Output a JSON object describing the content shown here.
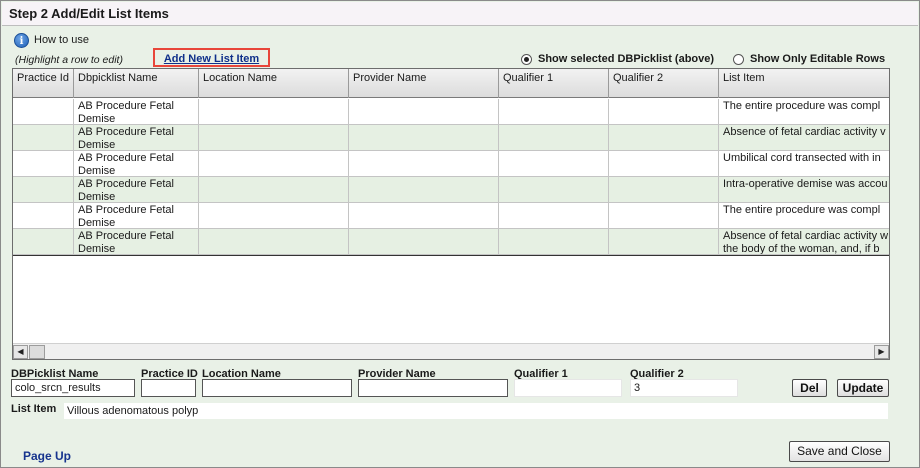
{
  "title": "Step 2 Add/Edit List Items",
  "how_to_use": "How to use",
  "hint": "(Highlight a row to edit)",
  "add_new": "Add New List Item",
  "radio_show_selected": "Show selected DBPicklist (above)",
  "radio_show_editable": "Show Only Editable Rows",
  "columns": [
    "Practice Id",
    "Dbpicklist Name",
    "Location Name",
    "Provider Name",
    "Qualifier 1",
    "Qualifier 2",
    "List Item"
  ],
  "rows": [
    {
      "practice_id": "",
      "dbpicklist": "AB Procedure Fetal Demise",
      "location": "",
      "provider": "",
      "q1": "",
      "q2": "",
      "list_item": "The entire procedure was compl"
    },
    {
      "practice_id": "",
      "dbpicklist": "AB Procedure Fetal Demise",
      "location": "",
      "provider": "",
      "q1": "",
      "q2": "",
      "list_item": "Absence of fetal cardiac activity v"
    },
    {
      "practice_id": "",
      "dbpicklist": "AB Procedure Fetal Demise",
      "location": "",
      "provider": "",
      "q1": "",
      "q2": "",
      "list_item": "Umbilical cord transected with in"
    },
    {
      "practice_id": "",
      "dbpicklist": "AB Procedure Fetal Demise",
      "location": "",
      "provider": "",
      "q1": "",
      "q2": "",
      "list_item": "Intra-operative demise was accou"
    },
    {
      "practice_id": "",
      "dbpicklist": "AB Procedure Fetal Demise",
      "location": "",
      "provider": "",
      "q1": "",
      "q2": "",
      "list_item": "The entire procedure was compl"
    },
    {
      "practice_id": "",
      "dbpicklist": "AB Procedure Fetal Demise",
      "location": "",
      "provider": "",
      "q1": "",
      "q2": "",
      "list_item": "Absence of fetal cardiac activity w the body of the woman, and, if b"
    }
  ],
  "form": {
    "dbpicklist_label": "DBPicklist Name",
    "dbpicklist_value": "colo_srcn_results",
    "practice_label": "Practice ID",
    "practice_value": "",
    "location_label": "Location Name",
    "location_value": "",
    "provider_label": "Provider Name",
    "provider_value": "",
    "q1_label": "Qualifier 1",
    "q1_value": "",
    "q2_label": "Qualifier 2",
    "q2_value": "3",
    "del": "Del",
    "update": "Update",
    "list_item_label": "List Item",
    "list_item_value": "Villous adenomatous polyp"
  },
  "page_up": "Page Up",
  "save_close": "Save and Close"
}
